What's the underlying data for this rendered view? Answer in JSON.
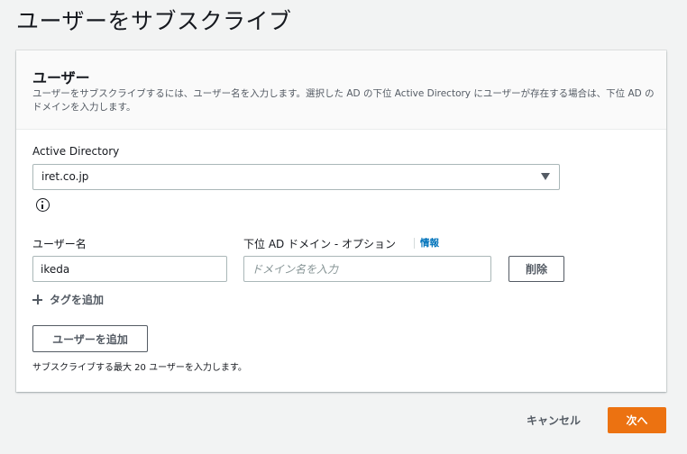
{
  "page": {
    "title": "ユーザーをサブスクライブ"
  },
  "panel": {
    "title": "ユーザー",
    "description": "ユーザーをサブスクライブするには、ユーザー名を入力します。選択した AD の下位 Active Directory にユーザーが存在する場合は、下位 AD のドメインを入力します。"
  },
  "directory": {
    "label": "Active Directory",
    "selected": "iret.co.jp"
  },
  "user_row": {
    "username_label": "ユーザー名",
    "username_value": "ikeda",
    "domain_label": "下位 AD ドメイン - オプション",
    "info_link": "情報",
    "domain_placeholder": "ドメイン名を入力",
    "delete_label": "削除"
  },
  "add_tag_label": "タグを追加",
  "add_user_label": "ユーザーを追加",
  "hint": "サブスクライブする最大 20 ユーザーを入力します。",
  "footer": {
    "cancel_label": "キャンセル",
    "next_label": "次へ"
  }
}
